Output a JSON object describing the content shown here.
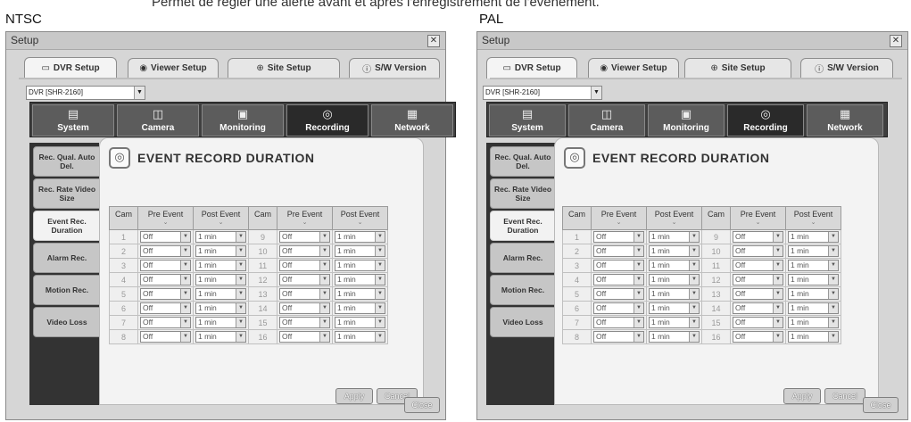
{
  "caption": "Permet de régler une alerte avant et après l'enregistrement de l'événement.",
  "panels": [
    {
      "standard": "NTSC",
      "window_title": "Setup",
      "close_x": "✕",
      "tabs": [
        {
          "label": "DVR Setup",
          "icon": "dvr-icon",
          "active": true
        },
        {
          "label": "Viewer Setup",
          "icon": "viewer-icon",
          "active": false
        },
        {
          "label": "Site Setup",
          "icon": "globe-icon",
          "active": false
        },
        {
          "label": "S/W Version",
          "icon": "info-icon",
          "active": false
        }
      ],
      "dvr_select": "DVR [SHR-2160]",
      "categories": [
        {
          "label": "System",
          "icon": "system-icon",
          "active": false
        },
        {
          "label": "Camera",
          "icon": "camera-icon",
          "active": false
        },
        {
          "label": "Monitoring",
          "icon": "monitor-icon",
          "active": false
        },
        {
          "label": "Recording",
          "icon": "recording-icon",
          "active": true
        },
        {
          "label": "Network",
          "icon": "network-icon",
          "active": false
        }
      ],
      "side_items": [
        {
          "label": "Rec. Qual. Auto Del.",
          "active": false
        },
        {
          "label": "Rec. Rate Video Size",
          "active": false
        },
        {
          "label": "Event Rec. Duration",
          "active": true
        },
        {
          "label": "Alarm Rec.",
          "active": false
        },
        {
          "label": "Motion Rec.",
          "active": false
        },
        {
          "label": "Video Loss",
          "active": false
        }
      ],
      "section_title": "EVENT RECORD DURATION",
      "columns": [
        "Cam",
        "Pre Event",
        "Post Event",
        "Cam",
        "Pre Event",
        "Post Event"
      ],
      "rows": [
        {
          "cam_a": "1",
          "pre_a": "Off",
          "post_a": "1 min",
          "cam_b": "9",
          "pre_b": "Off",
          "post_b": "1 min"
        },
        {
          "cam_a": "2",
          "pre_a": "Off",
          "post_a": "1 min",
          "cam_b": "10",
          "pre_b": "Off",
          "post_b": "1 min"
        },
        {
          "cam_a": "3",
          "pre_a": "Off",
          "post_a": "1 min",
          "cam_b": "11",
          "pre_b": "Off",
          "post_b": "1 min"
        },
        {
          "cam_a": "4",
          "pre_a": "Off",
          "post_a": "1 min",
          "cam_b": "12",
          "pre_b": "Off",
          "post_b": "1 min"
        },
        {
          "cam_a": "5",
          "pre_a": "Off",
          "post_a": "1 min",
          "cam_b": "13",
          "pre_b": "Off",
          "post_b": "1 min"
        },
        {
          "cam_a": "6",
          "pre_a": "Off",
          "post_a": "1 min",
          "cam_b": "14",
          "pre_b": "Off",
          "post_b": "1 min"
        },
        {
          "cam_a": "7",
          "pre_a": "Off",
          "post_a": "1 min",
          "cam_b": "15",
          "pre_b": "Off",
          "post_b": "1 min"
        },
        {
          "cam_a": "8",
          "pre_a": "Off",
          "post_a": "1 min",
          "cam_b": "16",
          "pre_b": "Off",
          "post_b": "1 min"
        }
      ],
      "apply_label": "Apply",
      "cancel_label": "Cancel",
      "close_label": "Close"
    },
    {
      "standard": "PAL",
      "window_title": "Setup",
      "close_x": "✕",
      "tabs": [
        {
          "label": "DVR Setup",
          "icon": "dvr-icon",
          "active": true
        },
        {
          "label": "Viewer Setup",
          "icon": "viewer-icon",
          "active": false
        },
        {
          "label": "Site Setup",
          "icon": "globe-icon",
          "active": false
        },
        {
          "label": "S/W Version",
          "icon": "info-icon",
          "active": false
        }
      ],
      "dvr_select": "DVR [SHR-2160]",
      "categories": [
        {
          "label": "System",
          "icon": "system-icon",
          "active": false
        },
        {
          "label": "Camera",
          "icon": "camera-icon",
          "active": false
        },
        {
          "label": "Monitoring",
          "icon": "monitor-icon",
          "active": false
        },
        {
          "label": "Recording",
          "icon": "recording-icon",
          "active": true
        },
        {
          "label": "Network",
          "icon": "network-icon",
          "active": false
        }
      ],
      "side_items": [
        {
          "label": "Rec. Qual. Auto Del.",
          "active": false
        },
        {
          "label": "Rec. Rate Video Size",
          "active": false
        },
        {
          "label": "Event Rec. Duration",
          "active": true
        },
        {
          "label": "Alarm Rec.",
          "active": false
        },
        {
          "label": "Motion Rec.",
          "active": false
        },
        {
          "label": "Video Loss",
          "active": false
        }
      ],
      "section_title": "EVENT RECORD DURATION",
      "columns": [
        "Cam",
        "Pre Event",
        "Post Event",
        "Cam",
        "Pre Event",
        "Post Event"
      ],
      "rows": [
        {
          "cam_a": "1",
          "pre_a": "Off",
          "post_a": "1 min",
          "cam_b": "9",
          "pre_b": "Off",
          "post_b": "1 min"
        },
        {
          "cam_a": "2",
          "pre_a": "Off",
          "post_a": "1 min",
          "cam_b": "10",
          "pre_b": "Off",
          "post_b": "1 min"
        },
        {
          "cam_a": "3",
          "pre_a": "Off",
          "post_a": "1 min",
          "cam_b": "11",
          "pre_b": "Off",
          "post_b": "1 min"
        },
        {
          "cam_a": "4",
          "pre_a": "Off",
          "post_a": "1 min",
          "cam_b": "12",
          "pre_b": "Off",
          "post_b": "1 min"
        },
        {
          "cam_a": "5",
          "pre_a": "Off",
          "post_a": "1 min",
          "cam_b": "13",
          "pre_b": "Off",
          "post_b": "1 min"
        },
        {
          "cam_a": "6",
          "pre_a": "Off",
          "post_a": "1 min",
          "cam_b": "14",
          "pre_b": "Off",
          "post_b": "1 min"
        },
        {
          "cam_a": "7",
          "pre_a": "Off",
          "post_a": "1 min",
          "cam_b": "15",
          "pre_b": "Off",
          "post_b": "1 min"
        },
        {
          "cam_a": "8",
          "pre_a": "Off",
          "post_a": "1 min",
          "cam_b": "16",
          "pre_b": "Off",
          "post_b": "1 min"
        }
      ],
      "apply_label": "Apply",
      "cancel_label": "Cancel",
      "close_label": "Close"
    }
  ]
}
